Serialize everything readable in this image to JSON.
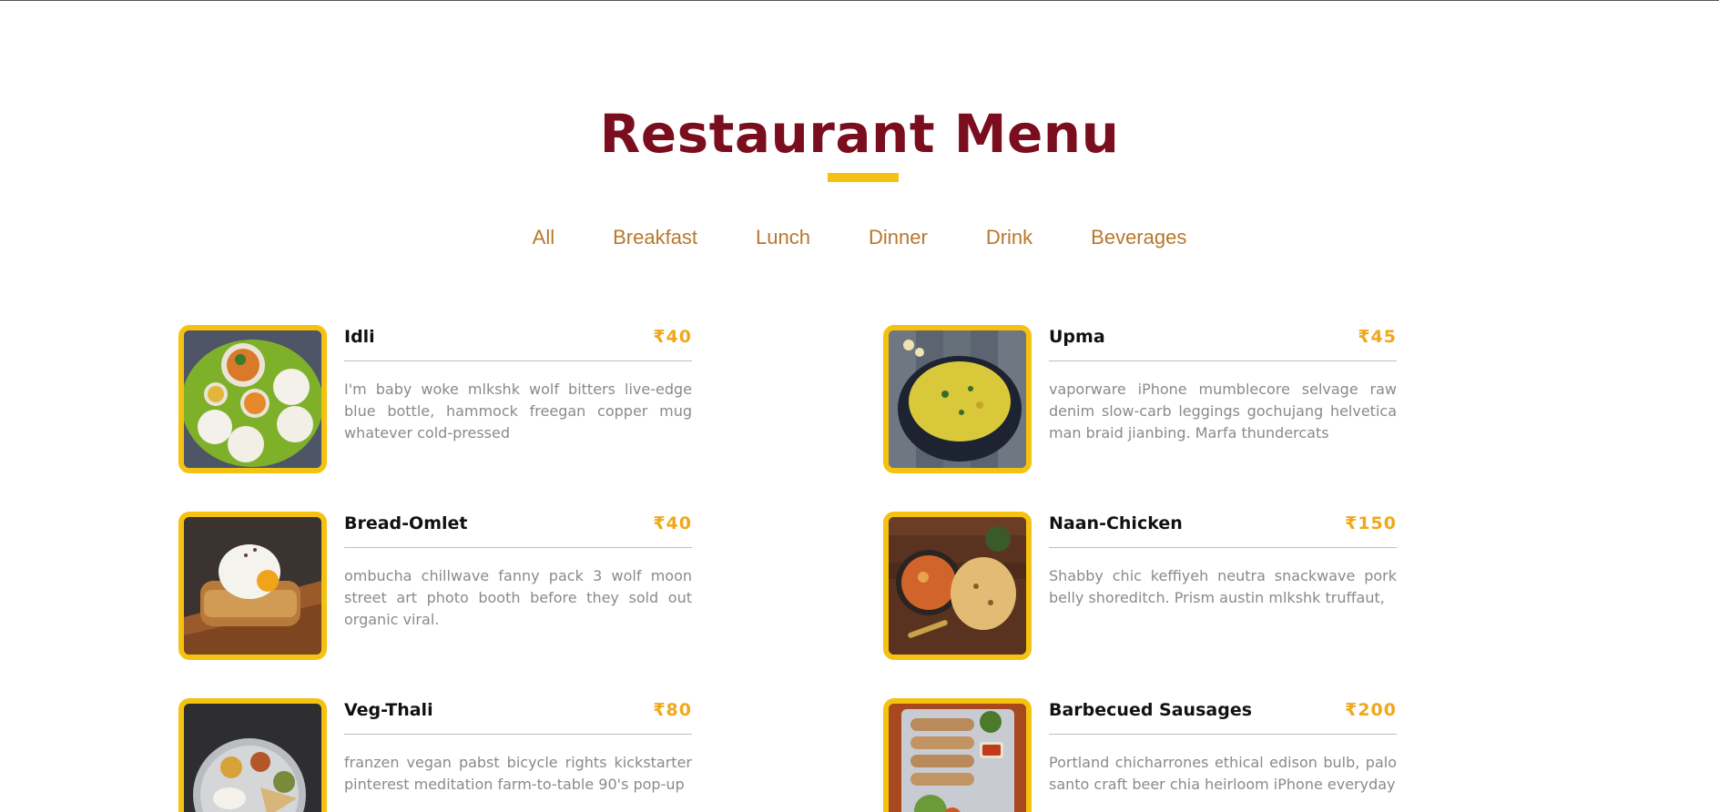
{
  "header": {
    "title": "Restaurant Menu"
  },
  "filters": [
    {
      "label": "All"
    },
    {
      "label": "Breakfast"
    },
    {
      "label": "Lunch"
    },
    {
      "label": "Dinner"
    },
    {
      "label": "Drink"
    },
    {
      "label": "Beverages"
    }
  ],
  "colors": {
    "title": "#7a0e1e",
    "accent": "#f5c211",
    "filter_text": "#b8772c",
    "price": "#f0a81a",
    "desc": "#8a8a8a"
  },
  "menu": [
    {
      "name": "Idli",
      "price": "₹40",
      "desc": "I'm baby woke mlkshk wolf bitters live-edge blue bottle, hammock freegan copper mug whatever cold-pressed",
      "image_icon": "idli-plate-icon"
    },
    {
      "name": "Upma",
      "price": "₹45",
      "desc": "vaporware iPhone mumblecore selvage raw denim slow-carb leggings gochujang helvetica man braid jianbing. Marfa thundercats",
      "image_icon": "upma-bowl-icon"
    },
    {
      "name": "Bread-Omlet",
      "price": "₹40",
      "desc": "ombucha chillwave fanny pack 3 wolf moon street art photo booth before they sold out organic viral.",
      "image_icon": "bread-omelet-icon"
    },
    {
      "name": "Naan-Chicken",
      "price": "₹150",
      "desc": "Shabby chic keffiyeh neutra snackwave pork belly shoreditch. Prism austin mlkshk truffaut,",
      "image_icon": "naan-chicken-icon"
    },
    {
      "name": "Veg-Thali",
      "price": "₹80",
      "desc": "franzen vegan pabst bicycle rights kickstarter pinterest meditation farm-to-table 90's pop-up",
      "image_icon": "veg-thali-icon"
    },
    {
      "name": "Barbecued Sausages",
      "price": "₹200",
      "desc": "Portland chicharrones ethical edison bulb, palo santo craft beer chia heirloom iPhone everyday",
      "image_icon": "sausages-platter-icon"
    }
  ]
}
